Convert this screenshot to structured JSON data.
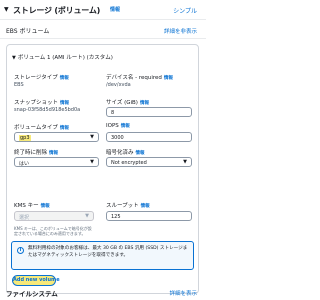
{
  "header": {
    "title": "ストレージ (ボリューム)",
    "info": "情報",
    "simple_link": "シンプル"
  },
  "ebs": {
    "heading": "EBS ボリューム",
    "advanced_link": "詳細を非表示"
  },
  "volume": {
    "heading": "ボリューム 1 (AMI ルート) (カスタム)",
    "fields": {
      "storage_type": {
        "label": "ストレージタイプ",
        "info": "情報",
        "value": "EBS"
      },
      "device_name": {
        "label": "デバイス名 - required",
        "info": "情報",
        "value": "/dev/xvda"
      },
      "snapshot": {
        "label": "スナップショット",
        "info": "情報",
        "value": "snap-03f58d5d918e5bd0a"
      },
      "size": {
        "label": "サイズ (GiB)",
        "info": "情報",
        "value": "8"
      },
      "volume_type": {
        "label": "ボリュームタイプ",
        "info": "情報",
        "value": "gp3"
      },
      "iops": {
        "label": "IOPS",
        "info": "情報",
        "value": "3000"
      },
      "delete_on_termination": {
        "label": "終了時に削除",
        "info": "情報",
        "value": "はい"
      },
      "encrypted": {
        "label": "暗号化済み",
        "info": "情報",
        "value": "Not encrypted"
      },
      "kms_key": {
        "label": "KMS キー",
        "info": "情報",
        "value": "選択",
        "description": "KMS キーは、このボリュームで暗号化が設定されている場合にのみ適用できます。"
      },
      "throughput": {
        "label": "スループット",
        "info": "情報",
        "value": "125"
      }
    },
    "alert": "無料利用枠の対象のお客様は、最大 30 GB の EBS 汎用 (SSD) ストレージまたはマグネティックストレージを取得できます。"
  },
  "add_volume_button": "Add new volume",
  "filesystem": {
    "heading": "ファイルシステム",
    "advanced_link": "詳細を表示"
  },
  "colors": {
    "link": "#0972d3",
    "highlight": "#f7e97a",
    "alert_bg": "#f2f8fd"
  },
  "icons": {
    "section_caret": "caret-down",
    "alert": "info-circle",
    "select_chevron": "chevron-down"
  }
}
